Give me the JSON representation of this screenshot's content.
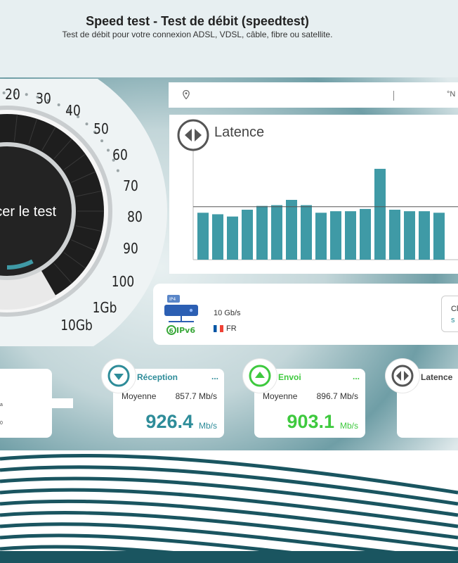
{
  "header": {
    "title": "Speed test - Test de débit (speedtest)",
    "subtitle": "Test de débit pour votre connexion ADSL, VDSL, câble, fibre ou satellite."
  },
  "topbar": {
    "location_icon": "location-pin-icon",
    "right_text": "°N ,"
  },
  "gauge": {
    "button_label": "cer le test",
    "scale_labels": [
      "20",
      "30",
      "40",
      "50",
      "60",
      "70",
      "80",
      "90",
      "100",
      "1Gb",
      "10Gb"
    ],
    "progress_fraction": 0.15
  },
  "latency_panel": {
    "title": "Latence",
    "icon": "latency-icon",
    "chart_data": {
      "type": "bar",
      "values": [
        62,
        60,
        57,
        66,
        71,
        72,
        79,
        72,
        62,
        64,
        64,
        67,
        120,
        66,
        64,
        64,
        62
      ],
      "reference_line": 70,
      "ylim": [
        0,
        145
      ],
      "color": "#3f9aa6"
    }
  },
  "connection": {
    "icon": "ipv6-server-icon",
    "ipv6_label": "IPv6",
    "ipv6_badge": "IP4",
    "speed": "10 Gb/s",
    "country": "FR"
  },
  "right_card": {
    "line1": "Cl",
    "line2": "s"
  },
  "left_card": {
    "line1": "a",
    "line2": "0"
  },
  "reception": {
    "title": "Réception",
    "icon": "download-arrow-icon",
    "dots": "...",
    "avg_label": "Moyenne",
    "avg_value": "857.7 Mb/s",
    "value": "926.4",
    "unit": "Mb/s",
    "color": "#2e8c99"
  },
  "envoi": {
    "title": "Envoi",
    "icon": "upload-arrow-icon",
    "dots": "...",
    "avg_label": "Moyenne",
    "avg_value": "896.7 Mb/s",
    "value": "903.1",
    "unit": "Mb/s",
    "color": "#3ec93e"
  },
  "latence_card": {
    "title": "Latence",
    "icon": "latency-icon"
  }
}
